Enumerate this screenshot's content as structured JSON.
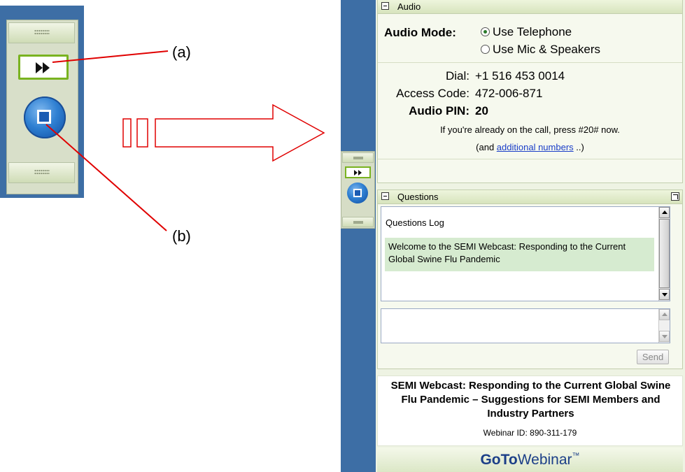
{
  "callouts": {
    "a": "(a)",
    "b": "(b)"
  },
  "audio": {
    "header": "Audio",
    "mode_label": "Audio Mode:",
    "option_telephone": "Use Telephone",
    "option_mic": "Use Mic & Speakers",
    "selected": "Use Telephone",
    "dial_label": "Dial:",
    "dial_value": "+1 516 453 0014",
    "access_label": "Access Code:",
    "access_value": "472-006-871",
    "pin_label": "Audio PIN:",
    "pin_value": "20",
    "already_note": "If you're already on the call, press #20# now.",
    "additional_prefix": "(and ",
    "additional_link": "additional numbers",
    "additional_suffix": " ..)"
  },
  "questions": {
    "header": "Questions",
    "log_title": "Questions Log",
    "message": "Welcome to the SEMI Webcast: Responding to the Current Global Swine Flu Pandemic",
    "input_value": "",
    "send_label": "Send"
  },
  "footer": {
    "title": "SEMI Webcast: Responding to the Current Global Swine Flu Pandemic – Suggestions for SEMI Members and Industry Partners",
    "webinar_id": "Webinar ID: 890-311-179",
    "brand_goto": "GoTo",
    "brand_webinar": "Webinar",
    "brand_tm": "™"
  },
  "colors": {
    "accent_green": "#79b320",
    "side_blue": "#3d6ea5",
    "panel_bg": "#eef3e3",
    "callout_red": "#e00000"
  },
  "icons": [
    "grip-icon",
    "play-forward-icon",
    "stop-icon",
    "minus-icon",
    "popout-icon",
    "radio-icon",
    "scroll-up-icon",
    "scroll-down-icon"
  ]
}
